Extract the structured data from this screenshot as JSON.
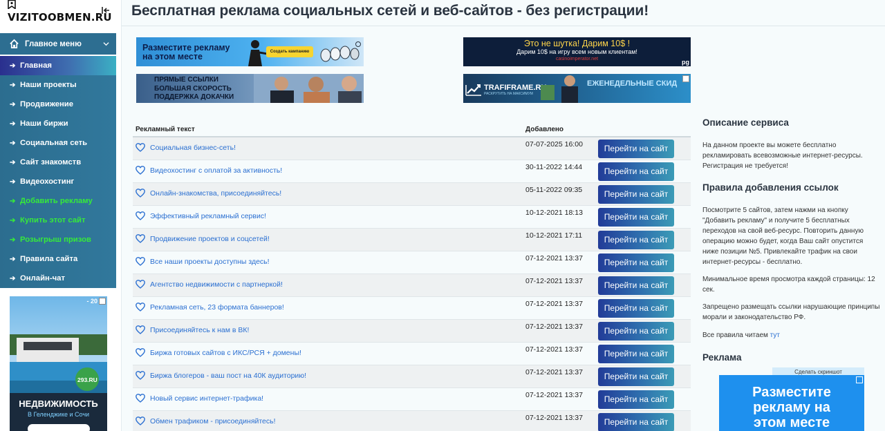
{
  "logo": {
    "text": "VIZITOOBMEN.RU"
  },
  "sidebar": {
    "menu_header": "Главное меню",
    "items": [
      {
        "label": "Главная",
        "active": true,
        "color": "#ffffff"
      },
      {
        "label": "Наши проекты"
      },
      {
        "label": "Продвижение"
      },
      {
        "label": "Наши биржи"
      },
      {
        "label": "Социальная сеть"
      },
      {
        "label": "Сайт знакомств"
      },
      {
        "label": "Видеохостинг"
      },
      {
        "label": "Добавить рекламу",
        "color": "#36ea3a"
      },
      {
        "label": "Купить этот сайт",
        "color": "#36ea3a"
      },
      {
        "label": "Розыгрыш призов",
        "color": "#36ea3a"
      },
      {
        "label": "Правила сайта"
      },
      {
        "label": "Онлайн-чат"
      }
    ],
    "ad": {
      "badge": "- 20",
      "site": "293.RU",
      "headline": "НЕДВИЖИМОСТЬ",
      "sub": "В Геленджике и Сочи"
    }
  },
  "header": {
    "title": "Бесплатная реклама социальных сетей и веб-сайтов - без регистрации!"
  },
  "banners": {
    "b1": {
      "text_line1": "Разместите рекламу",
      "text_line2": "на этом месте",
      "button": "Создать кампанию"
    },
    "b2": {
      "line1": "Это не шутка! Дарим 10$ !",
      "line2": "Дарим 10$ на игру всем новым клиентам!",
      "line3": "casinoimperator.net",
      "tag": "pg"
    },
    "b3": {
      "line1": "ПРЯМЫЕ ССЫЛКИ",
      "line2": "БОЛЬШАЯ СКОРОСТЬ",
      "line3": "ПОДДЕРЖКА ДОКАЧКИ"
    },
    "b4": {
      "brand": "TRAFIFRAME.RU",
      "brand_sub": "РАСКРУТИТЬ НА МАКСИМУМ",
      "promo": "ЕЖЕНЕДЕЛЬНЫЕ СКИД"
    }
  },
  "table": {
    "col_text": "Рекламный текст",
    "col_added": "Добавлено",
    "button_label": "Перейти на сайт",
    "rows": [
      {
        "text": "Социальная бизнес-сеть!",
        "date": "07-07-2025 16:00"
      },
      {
        "text": "Видеохостинг с оплатой за активность!",
        "date": "30-11-2022 14:44"
      },
      {
        "text": "Онлайн-знакомства, присоединяйтесь!",
        "date": "05-11-2022 09:35"
      },
      {
        "text": "Эффективный рекламный сервис!",
        "date": "10-12-2021 18:13"
      },
      {
        "text": "Продвижение проектов и соцсетей!",
        "date": "10-12-2021 17:11"
      },
      {
        "text": "Все наши проекты доступны здесь!",
        "date": "07-12-2021 13:37"
      },
      {
        "text": "Агентство недвижимости с партнеркой!",
        "date": "07-12-2021 13:37"
      },
      {
        "text": "Рекламная сеть, 23 формата баннеров!",
        "date": "07-12-2021 13:37"
      },
      {
        "text": "Присоединяйтесь к нам в ВК!",
        "date": "07-12-2021 13:37"
      },
      {
        "text": "Биржа готовых сайтов с ИКС/РСЯ + домены!",
        "date": "07-12-2021 13:37"
      },
      {
        "text": "Биржа блогеров - ваш пост на 40К аудиторию!",
        "date": "07-12-2021 13:37"
      },
      {
        "text": "Новый сервис интернет-трафика!",
        "date": "07-12-2021 13:37"
      },
      {
        "text": "Обмен трафиком - присоединяйтесь!",
        "date": "07-12-2021 13:37"
      }
    ]
  },
  "right": {
    "desc_title": "Описание сервиса",
    "desc_text": "На данном проекте вы можете бесплатно рекламировать всевозможные интернет-ресурсы. Регистрация не требуется!",
    "rules_title": "Правила добавления ссылок",
    "rules_p1": "Посмотрите 5 сайтов, затем нажми на кнопку \"Добавить рекламу\" и получите 5 бесплатных переходов на свой веб-ресурс. Повторить данную операцию можно будет, когда Ваш сайт опустится ниже позиции №5. Привлекайте трафик на свои интернет-ресурсы - бесплатно.",
    "rules_p2": "Минимальное время просмотра каждой страницы: 12 сек.",
    "rules_p3": "Запрещено размещать ссылки нарушающие принципы морали и законодательство РФ.",
    "rules_p4_prefix": "Все правила читаем ",
    "rules_p4_link": "тут",
    "ads_title": "Реклама",
    "screenshot_btn": "Сделать скриншот",
    "ad_text_l1": "Разместите",
    "ad_text_l2": "рекламу на",
    "ad_text_l3": "этом месте"
  }
}
